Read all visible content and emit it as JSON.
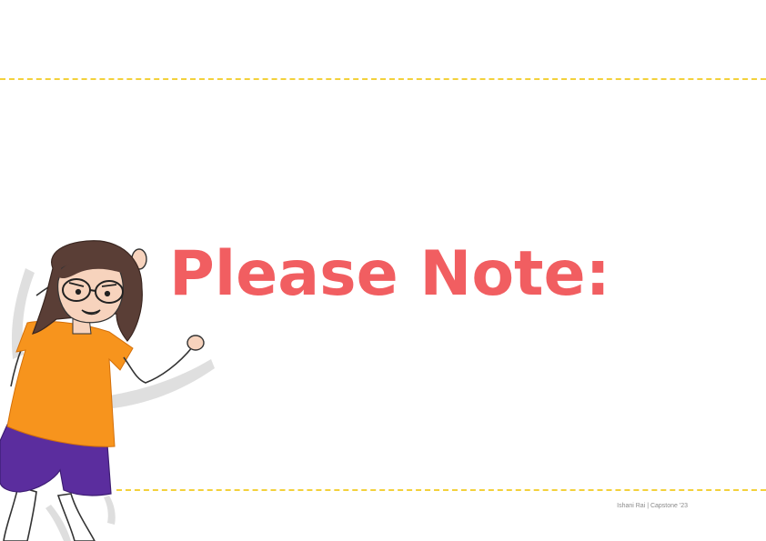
{
  "slide": {
    "title": "Please Note:",
    "footer": "Ishani Rai | Capstone '23",
    "illustration": "girl-with-glasses-character-illustration"
  },
  "colors": {
    "title": "#f15e61",
    "dashed_rule": "#f3d13b",
    "shirt": "#f7941d",
    "shorts": "#5b2d9e",
    "hair": "#5a3e36",
    "skin": "#f7d3bd",
    "footer_text": "#8a8a8a"
  }
}
